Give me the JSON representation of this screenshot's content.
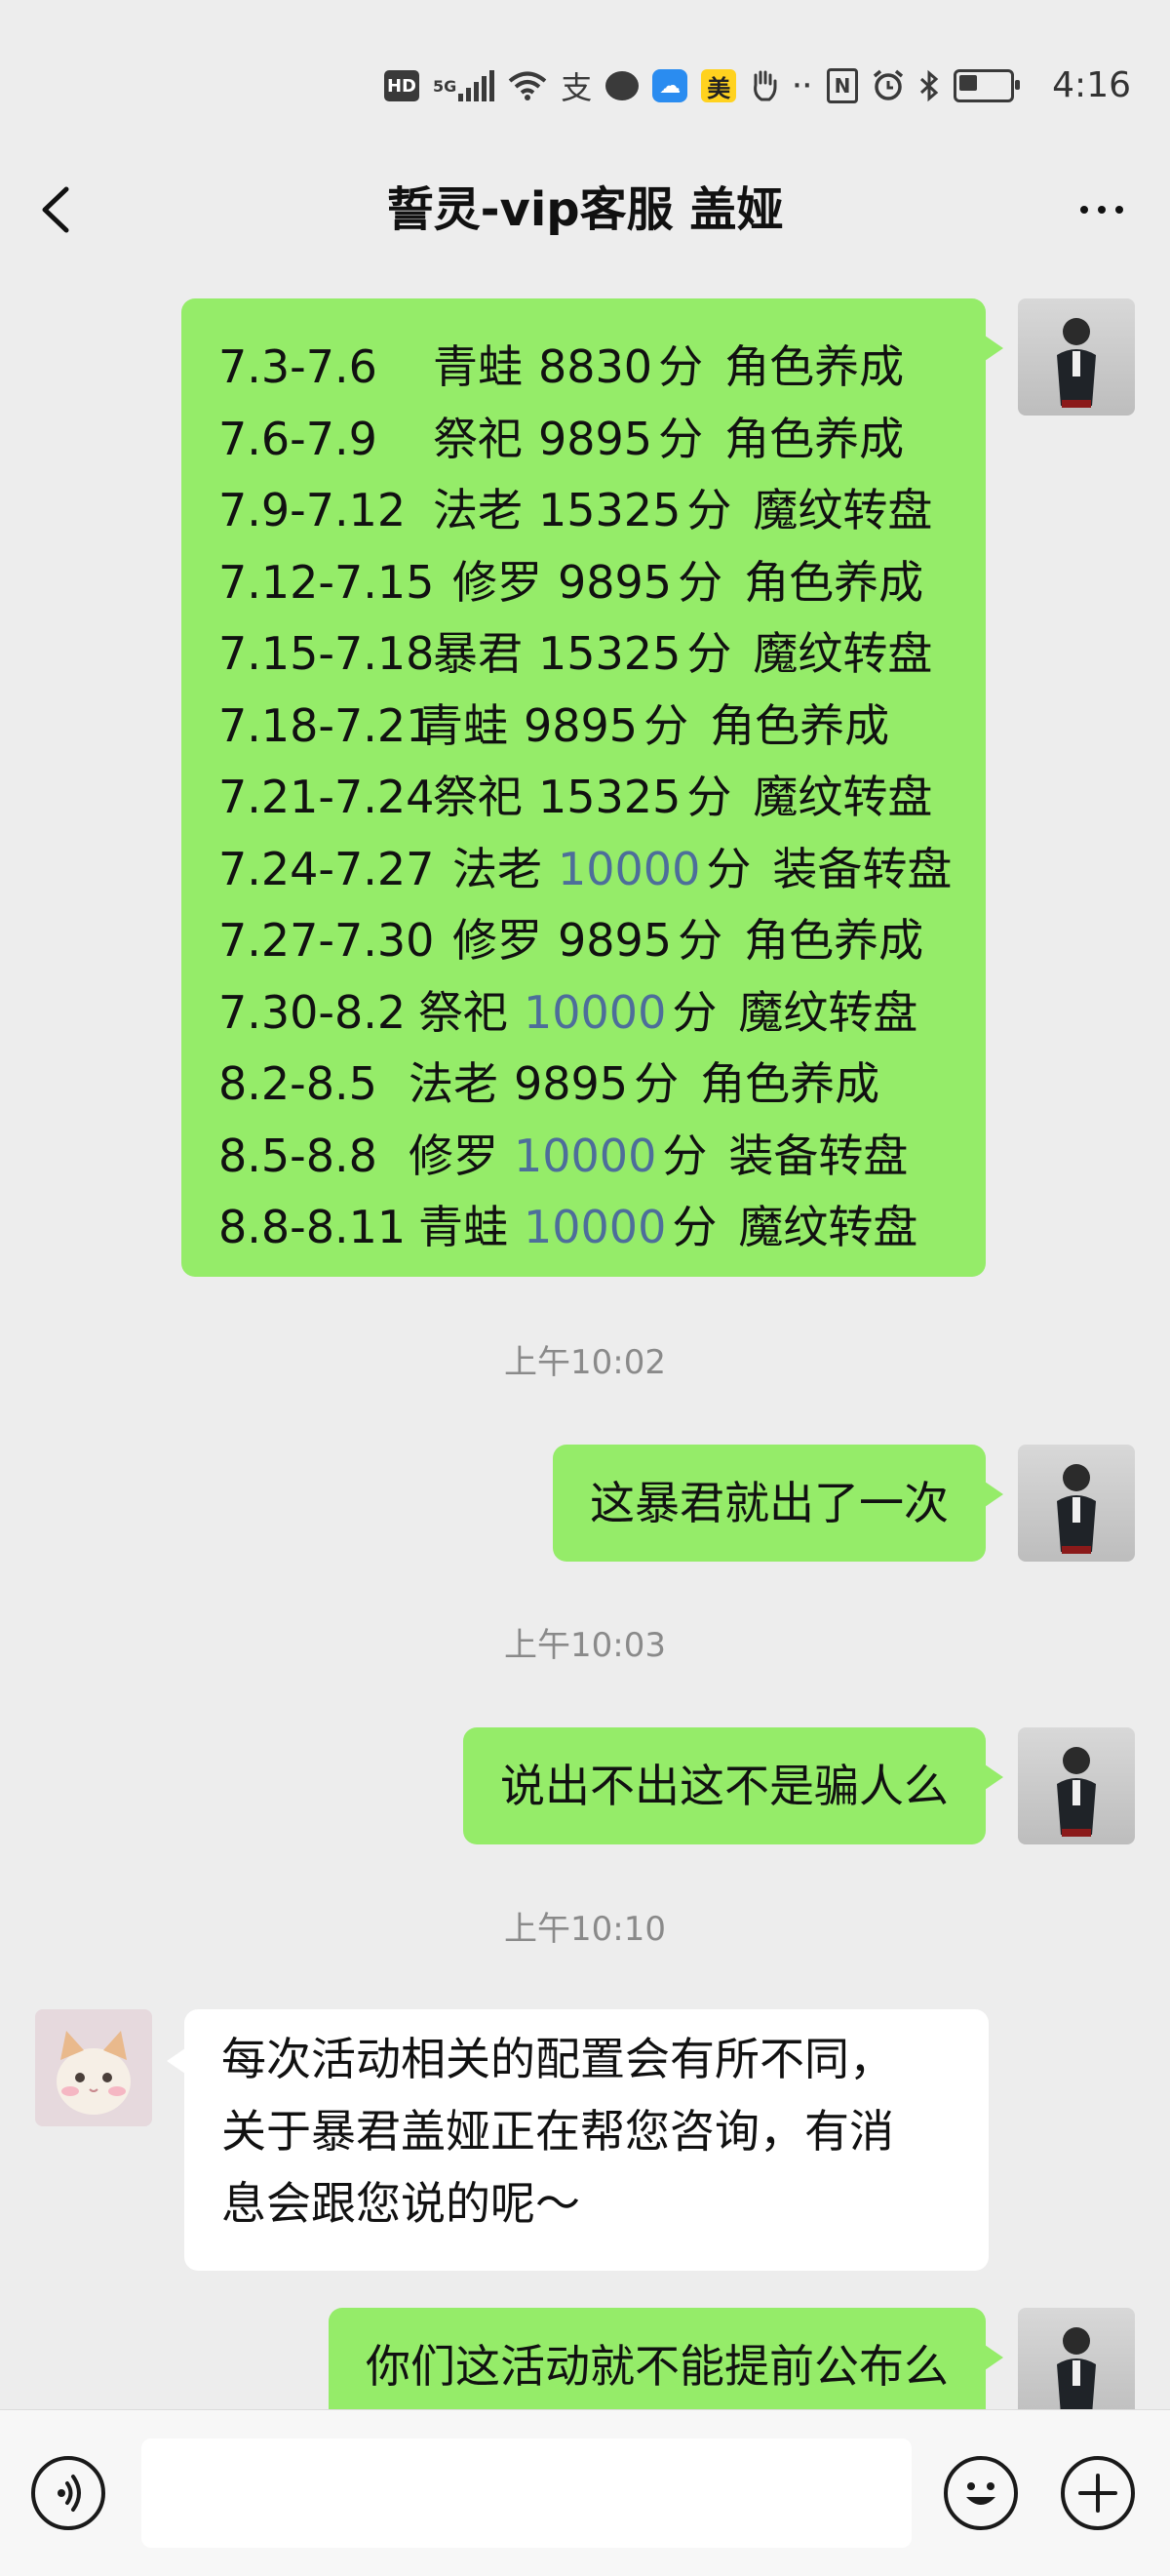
{
  "status_bar": {
    "hd_label": "HD",
    "net_label": "5G",
    "pay_icon": "支",
    "mei_icon": "美",
    "nfc_label": "N",
    "time": "4:16"
  },
  "nav": {
    "title": "誓灵-vip客服 盖娅"
  },
  "schedule": [
    {
      "date": "7.3-7.6",
      "name": "青蛙",
      "points": "8830",
      "unit": "分",
      "reward": "角色养成",
      "points_link": false
    },
    {
      "date": "7.6-7.9",
      "name": "祭祀",
      "points": "9895",
      "unit": "分",
      "reward": "角色养成",
      "points_link": false
    },
    {
      "date": "7.9-7.12",
      "name": "法老",
      "points": "15325",
      "unit": "分",
      "reward": "魔纹转盘",
      "points_link": false
    },
    {
      "date": "7.12-7.15",
      "name": "修罗",
      "points": "9895",
      "unit": "分",
      "reward": "角色养成",
      "points_link": false
    },
    {
      "date": "7.15-7.18",
      "name": "暴君",
      "points": "15325",
      "unit": "分",
      "reward": "魔纹转盘",
      "points_link": false
    },
    {
      "date": "7.18-7.21",
      "name": "青蛙",
      "points": "9895",
      "unit": "分",
      "reward": "角色养成",
      "points_link": false
    },
    {
      "date": "7.21-7.24",
      "name": "祭祀",
      "points": "15325",
      "unit": "分",
      "reward": "魔纹转盘",
      "points_link": false
    },
    {
      "date": "7.24-7.27",
      "name": "法老",
      "points": "10000",
      "unit": "分",
      "reward": "装备转盘",
      "points_link": true
    },
    {
      "date": "7.27-7.30",
      "name": "修罗",
      "points": "9895",
      "unit": "分",
      "reward": "角色养成",
      "points_link": false
    },
    {
      "date": "7.30-8.2",
      "name": "祭祀",
      "points": "10000",
      "unit": "分",
      "reward": "魔纹转盘",
      "points_link": true
    },
    {
      "date": "8.2-8.5",
      "name": "法老",
      "points": "9895",
      "unit": "分",
      "reward": "角色养成",
      "points_link": false
    },
    {
      "date": "8.5-8.8",
      "name": "修罗",
      "points": "10000",
      "unit": "分",
      "reward": "装备转盘",
      "points_link": true
    },
    {
      "date": "8.8-8.11",
      "name": "青蛙",
      "points": "10000",
      "unit": "分",
      "reward": "魔纹转盘",
      "points_link": true
    }
  ],
  "messages": {
    "ts1": "上午10:02",
    "m1": "这暴君就出了一次",
    "ts2": "上午10:03",
    "m2": "说出不出这不是骗人么",
    "ts3": "上午10:10",
    "reply_lines": [
      "每次活动相关的配置会有所不同，",
      "关于暴君盖娅正在帮您咨询，有消",
      "息会跟您说的呢～"
    ],
    "m3": "你们这活动就不能提前公布么"
  },
  "input_bar": {
    "placeholder": ""
  },
  "colors": {
    "sent_bubble": "#95ec69",
    "recv_bubble": "#ffffff",
    "background": "#ededed",
    "link_number": "#4d6e9a"
  }
}
